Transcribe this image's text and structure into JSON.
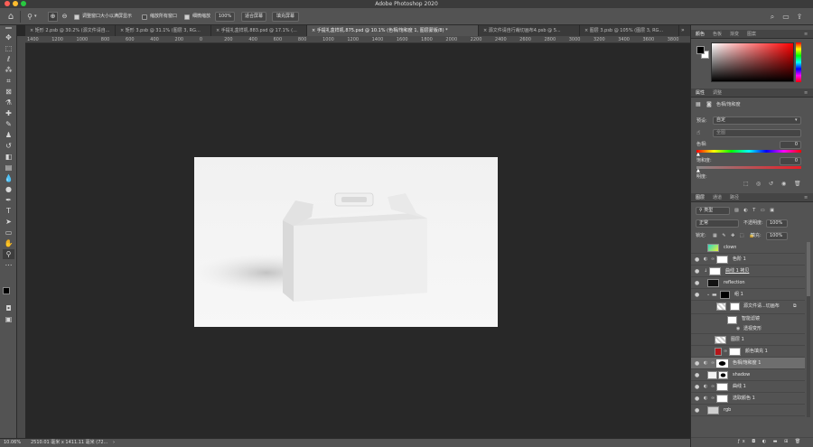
{
  "app": {
    "title": "Adobe Photoshop 2020"
  },
  "options_bar": {
    "zoom_tool_symbol": "🔍",
    "checkbox_resize_label": "调整窗口大小以满屏显示",
    "checkbox_resize_checked": true,
    "checkbox_all_windows_label": "缩放所有窗口",
    "checkbox_all_windows_checked": false,
    "checkbox_scrubby_label": "细微缩放",
    "checkbox_scrubby_checked": true,
    "zoom_value": "100%",
    "fit_screen_label": "适合屏幕",
    "fill_screen_label": "填充屏幕"
  },
  "tabs": [
    {
      "label": "矩形 2.psb @ 30.2% (源文件请自...",
      "active": false
    },
    {
      "label": "矩形 3.psb @ 31.1% (图层 3, RG...",
      "active": false
    },
    {
      "label": "手提礼盒样机.883.psd @ 17.1% (...",
      "active": false
    },
    {
      "label": "手提礼盒样机.875.psd @ 10.1% (色相/饱和度 1, 图层蒙版/8) *",
      "active": true
    },
    {
      "label": "源文件请自行裁切画布4.psb @ 5...",
      "active": false
    },
    {
      "label": "图层 3.psb @ 105% (图层 3, RG...",
      "active": false
    }
  ],
  "ruler_top": [
    "1400",
    "1200",
    "1000",
    "800",
    "600",
    "400",
    "200",
    "0",
    "200",
    "400",
    "600",
    "800",
    "1000",
    "1200",
    "1400",
    "1600",
    "1800",
    "2000",
    "2200",
    "2400",
    "2600",
    "2800",
    "3000",
    "3200",
    "3400",
    "3600",
    "3800"
  ],
  "status_bar": {
    "zoom": "10.06%",
    "doc_size": "2510.01 毫米 x 1411.11 毫米 (72..."
  },
  "color_panel": {
    "tabs": [
      "颜色",
      "色板",
      "渐变",
      "图案"
    ],
    "active_tab": "颜色"
  },
  "properties_panel": {
    "tabs": [
      "属性",
      "调整"
    ],
    "title": "色相/饱和度",
    "preset_label": "预设:",
    "preset_value": "自定",
    "channel_value": "全图",
    "hue_label": "色相:",
    "hue_value": "0",
    "saturation_label": "饱和度:",
    "saturation_value": "0",
    "lightness_label": "明度:"
  },
  "layers_panel": {
    "tabs": [
      "图层",
      "通道",
      "路径"
    ],
    "filter_kind": "类型",
    "blend_mode": "正常",
    "opacity_label": "不透明度:",
    "opacity_value": "100%",
    "lock_label": "锁定:",
    "fill_label": "填充:",
    "fill_value": "100%",
    "layers": [
      {
        "name": "clown",
        "visible": false,
        "thumb": "#35d0c8"
      },
      {
        "name": "色阶 1",
        "visible": true,
        "thumb": "#ffffff"
      },
      {
        "name": "曲线 1 拷贝",
        "visible": true,
        "thumb": "#ffffff"
      },
      {
        "name": "reflection",
        "visible": true,
        "thumb": "#111111"
      },
      {
        "name": "组 1",
        "visible": true,
        "thumb": "#777777"
      },
      {
        "name": "源文件请...切画布",
        "visible": false,
        "thumb": "#dddddd"
      },
      {
        "name": "智能滤镜",
        "visible": false,
        "thumb": "#ffffff"
      },
      {
        "name": "透视变形",
        "visible": false,
        "thumb": ""
      },
      {
        "name": "图层 1",
        "visible": false,
        "thumb": "#d8d8d8"
      },
      {
        "name": "颜色填充 1",
        "visible": false,
        "thumb": "#b5161a"
      },
      {
        "name": "色相/饱和度 1",
        "visible": true,
        "thumb": "#ffffff",
        "selected": true
      },
      {
        "name": "shadow",
        "visible": true,
        "thumb": "#f4f4f4"
      },
      {
        "name": "曲线 1",
        "visible": true,
        "thumb": "#ffffff"
      },
      {
        "name": "选取颜色 1",
        "visible": true,
        "thumb": "#ffffff"
      },
      {
        "name": "rgb",
        "visible": true,
        "thumb": "#cfcfcf"
      }
    ]
  },
  "colors": {
    "foreground": "#000000",
    "background": "#ffffff",
    "accent": "#35d0c8"
  }
}
